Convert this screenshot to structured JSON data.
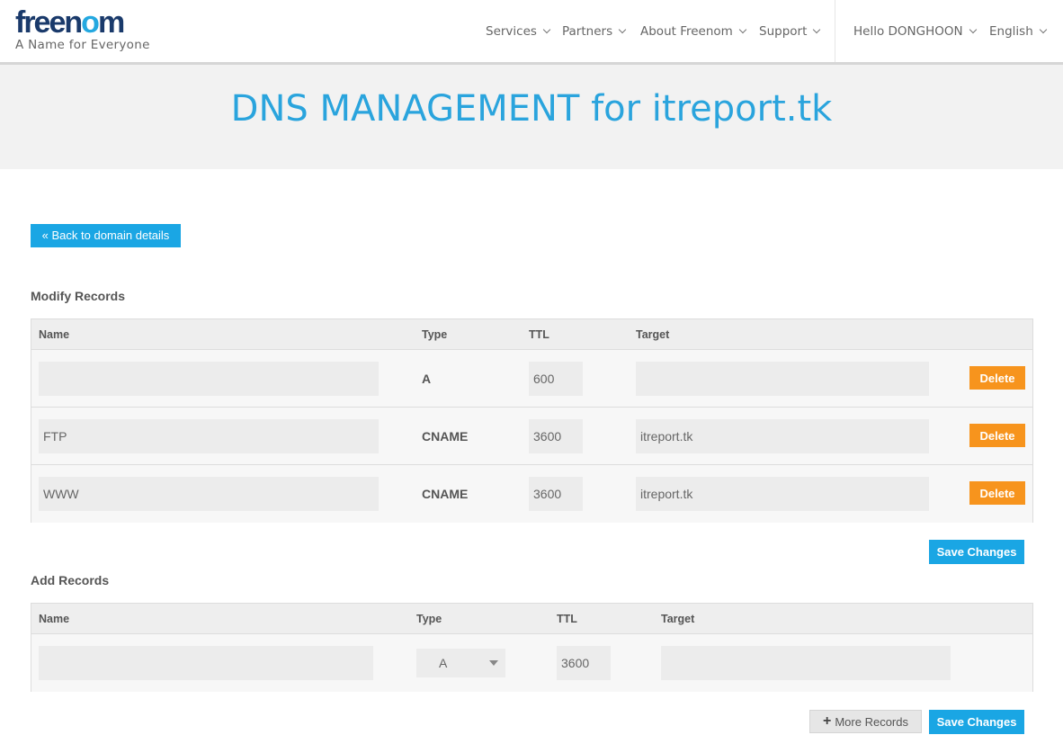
{
  "logo": {
    "brand_prefix": "free",
    "brand_o1": "n",
    "brand_mid": "o",
    "brand_suffix": "m",
    "tagline": "A Name for Everyone"
  },
  "nav": {
    "services": "Services",
    "partners": "Partners",
    "about": "About Freenom",
    "support": "Support",
    "user": "Hello DONGHOON",
    "language": "English"
  },
  "banner": {
    "title": "DNS MANAGEMENT for itreport.tk"
  },
  "back_button": "« Back to domain details",
  "modify": {
    "title": "Modify Records",
    "headers": {
      "name": "Name",
      "type": "Type",
      "ttl": "TTL",
      "target": "Target"
    },
    "rows": [
      {
        "name": "",
        "type": "A",
        "ttl": "600",
        "target": "",
        "delete": "Delete"
      },
      {
        "name": "FTP",
        "type": "CNAME",
        "ttl": "3600",
        "target": "itreport.tk",
        "delete": "Delete"
      },
      {
        "name": "WWW",
        "type": "CNAME",
        "ttl": "3600",
        "target": "itreport.tk",
        "delete": "Delete"
      }
    ],
    "save": "Save Changes"
  },
  "add": {
    "title": "Add Records",
    "headers": {
      "name": "Name",
      "type": "Type",
      "ttl": "TTL",
      "target": "Target"
    },
    "row": {
      "name": "",
      "type": "A",
      "ttl": "3600",
      "target": ""
    },
    "more": "More Records",
    "save": "Save Changes"
  },
  "colors": {
    "accent": "#1aa6e4",
    "delete": "#f7941d",
    "title": "#2aa4dd"
  }
}
